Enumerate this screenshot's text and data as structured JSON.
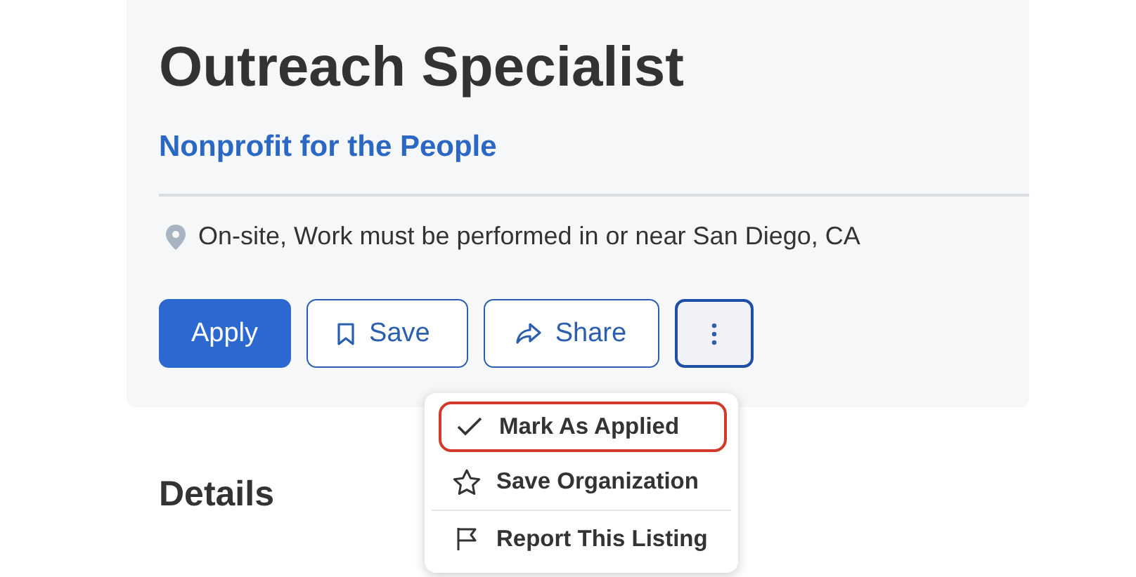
{
  "job": {
    "title": "Outreach Specialist",
    "organization": "Nonprofit for the People",
    "location": "On-site, Work must be performed in or near San Diego, CA"
  },
  "actions": [
    {
      "kind": "primary",
      "label": "Apply"
    },
    {
      "kind": "save",
      "label": "Save"
    },
    {
      "kind": "share",
      "label": "Share"
    }
  ],
  "more_button": {
    "expanded": true
  },
  "menu": [
    {
      "kind": "check",
      "label": "Mark As Applied",
      "highlighted": true
    },
    {
      "kind": "star",
      "label": "Save Organization",
      "highlighted": false
    },
    {
      "kind": "flag",
      "label": "Report This Listing",
      "highlighted": false
    }
  ],
  "section_heading": "Details"
}
